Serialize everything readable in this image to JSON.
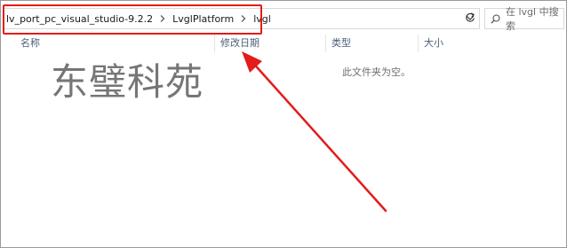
{
  "breadcrumb": {
    "items": [
      {
        "label": "lv_port_pc_visual_studio-9.2.2"
      },
      {
        "label": "LvglPlatform"
      },
      {
        "label": "lvgl"
      }
    ]
  },
  "search": {
    "placeholder": "在 lvgl 中搜索"
  },
  "columns": [
    {
      "label": "名称"
    },
    {
      "label": "修改日期"
    },
    {
      "label": "类型"
    },
    {
      "label": "大小"
    }
  ],
  "empty_message": "此文件夹为空。",
  "watermark": "东璧科苑",
  "icons": {
    "dropdown": "chevron-down-icon",
    "refresh": "refresh-icon",
    "search": "search-icon",
    "breadcrumb_separator": "chevron-right-icon"
  },
  "colors": {
    "highlight": "#e31b1b",
    "arrow": "#e31b1b",
    "column_header": "#4c607a"
  }
}
